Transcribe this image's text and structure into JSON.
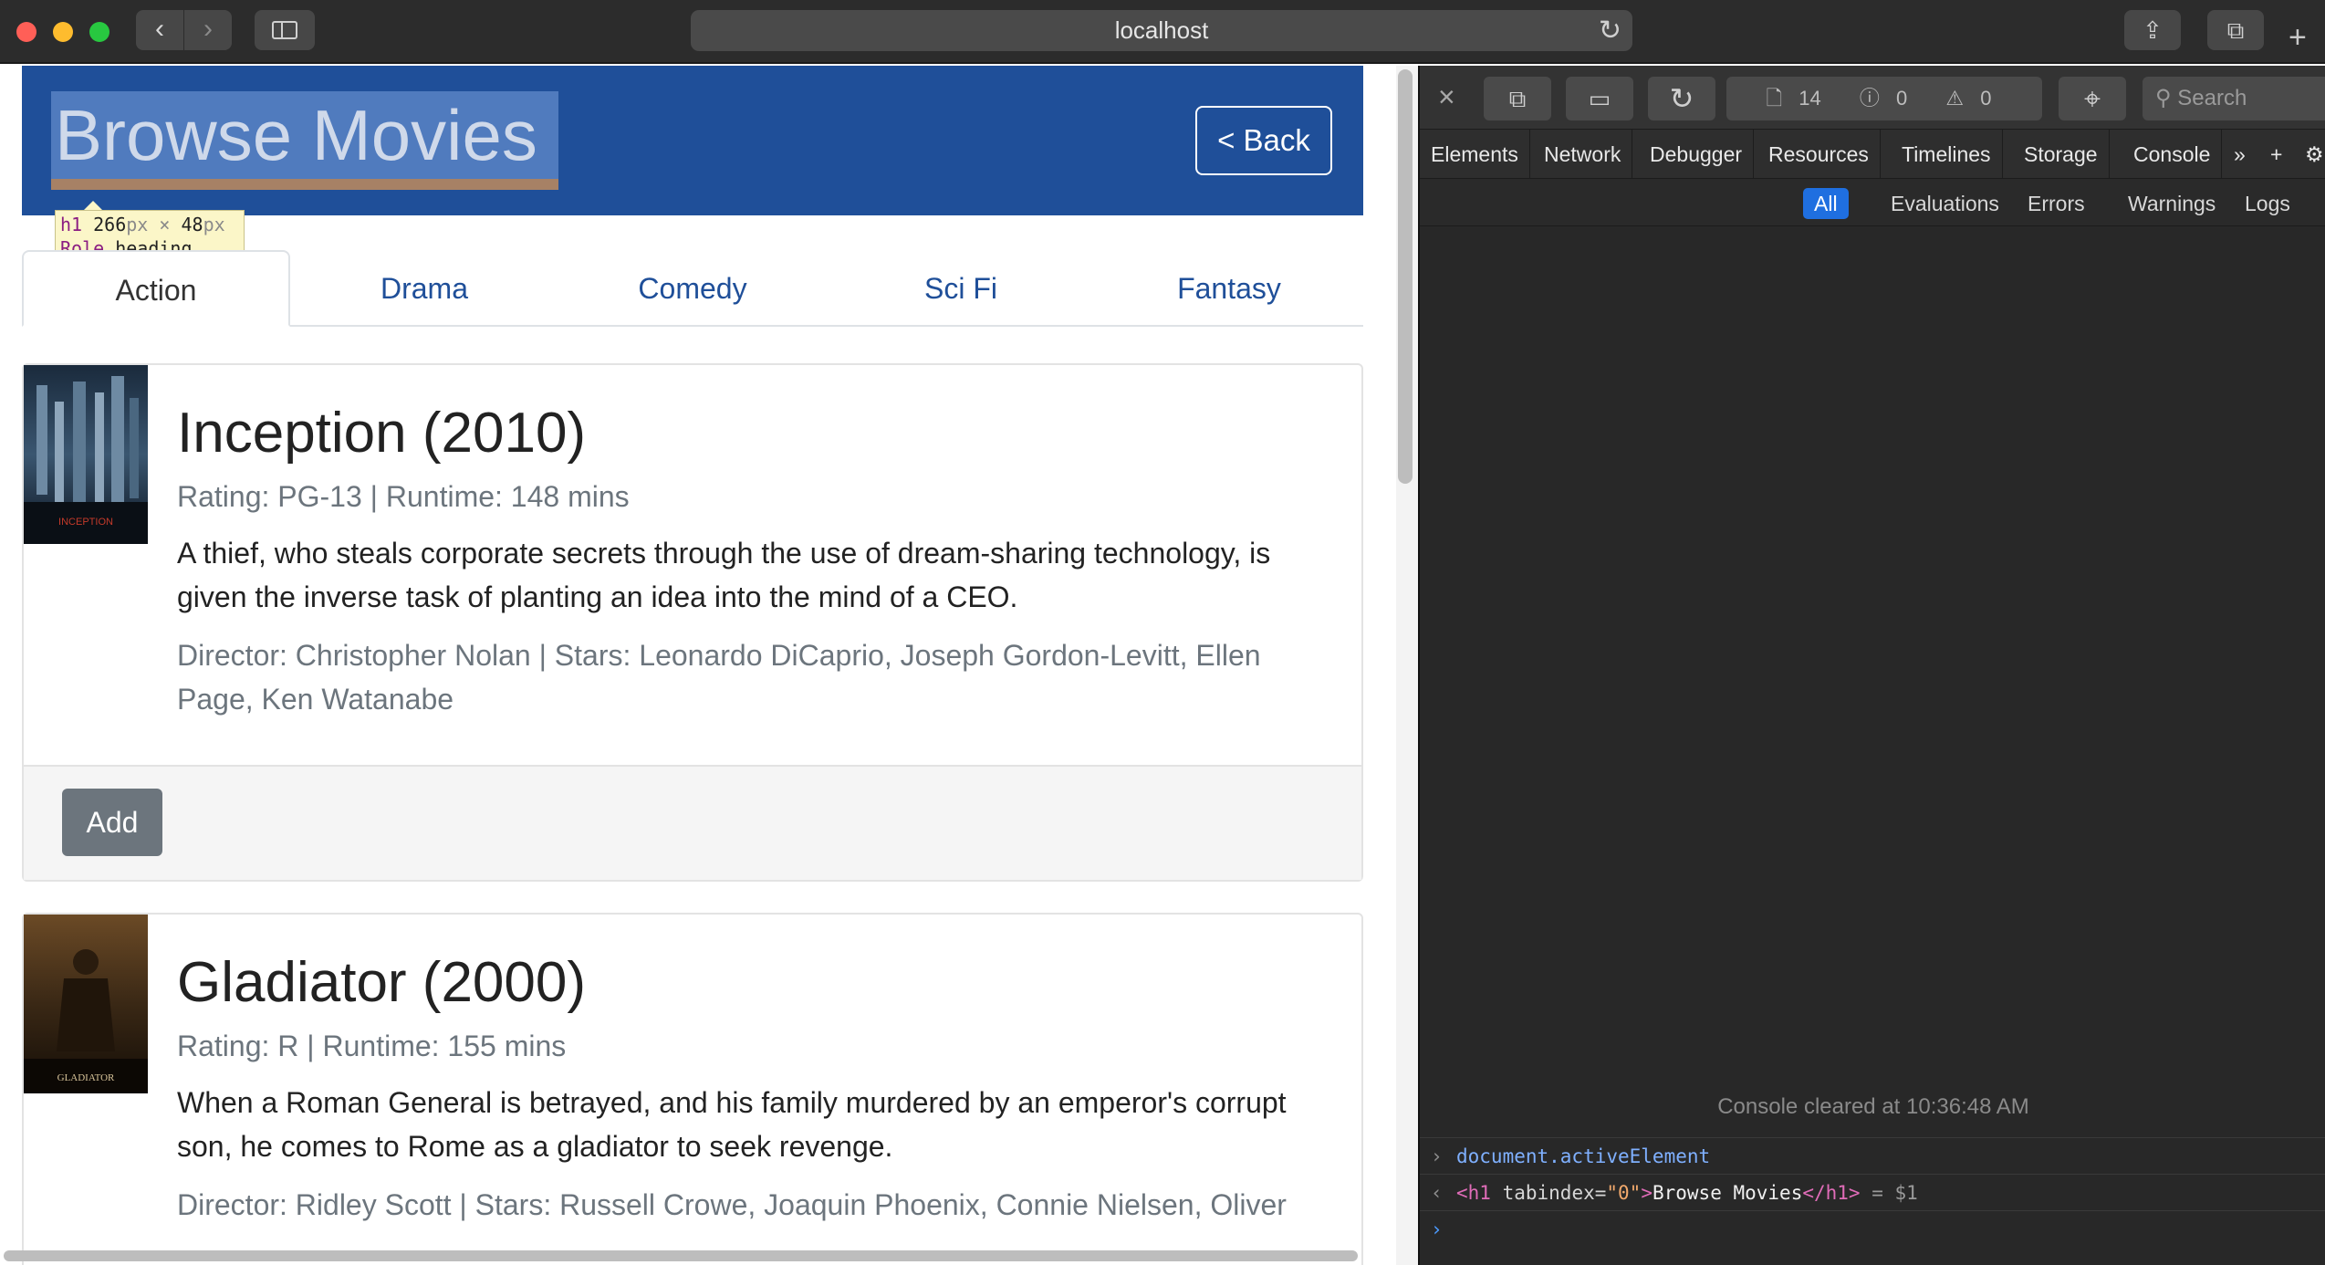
{
  "browser": {
    "url": "localhost",
    "nav_back": "‹",
    "nav_forward": "›",
    "reload_icon": "↻",
    "share_icon": "⇪",
    "tabs_icon": "⧉",
    "new_tab": "+"
  },
  "page": {
    "heading": "Browse Movies",
    "back_button": "< Back",
    "tooltip": {
      "tag": "h1",
      "width": "266",
      "height": "48",
      "px_unit": "px",
      "times": "×",
      "role_label": "Role",
      "role_value": "heading"
    },
    "tabs": [
      {
        "label": "Action",
        "active": true
      },
      {
        "label": "Drama",
        "active": false
      },
      {
        "label": "Comedy",
        "active": false
      },
      {
        "label": "Sci Fi",
        "active": false
      },
      {
        "label": "Fantasy",
        "active": false
      }
    ],
    "movies": [
      {
        "title": "Inception (2010)",
        "meta": "Rating: PG-13 | Runtime: 148 mins",
        "description": "A thief, who steals corporate secrets through the use of dream-sharing technology, is given the inverse task of planting an idea into the mind of a CEO.",
        "credits": "Director: Christopher Nolan | Stars: Leonardo DiCaprio, Joseph Gordon-Levitt, Ellen Page, Ken Watanabe",
        "poster_text": "INCEPTION",
        "add_label": "Add"
      },
      {
        "title": "Gladiator (2000)",
        "meta": "Rating: R | Runtime: 155 mins",
        "description": "When a Roman General is betrayed, and his family murdered by an emperor's corrupt son, he comes to Rome as a gladiator to seek revenge.",
        "credits": "Director: Ridley Scott | Stars: Russell Crowe, Joaquin Phoenix, Connie Nielsen, Oliver",
        "poster_text": "GLADIATOR"
      }
    ]
  },
  "inspector": {
    "close_icon": "×",
    "resource_count": "14",
    "error_count": "0",
    "warning_count": "0",
    "search_placeholder": "Search",
    "tabs": [
      "Elements",
      "Network",
      "Debugger",
      "Resources",
      "Timelines",
      "Storage",
      "Console"
    ],
    "more_tabs": "»",
    "add_tab": "+",
    "filters": [
      "All",
      "Evaluations",
      "Errors",
      "Warnings",
      "Logs"
    ],
    "console_cleared": "Console cleared at 10:36:48 AM",
    "command": "document.activeElement",
    "result": {
      "open_tag": "<h1",
      "attr_name": "tabindex=",
      "attr_value": "\"0\"",
      "close_bracket": ">",
      "text": "Browse Movies",
      "end_tag": "</h1>",
      "ref": "= $1"
    }
  }
}
